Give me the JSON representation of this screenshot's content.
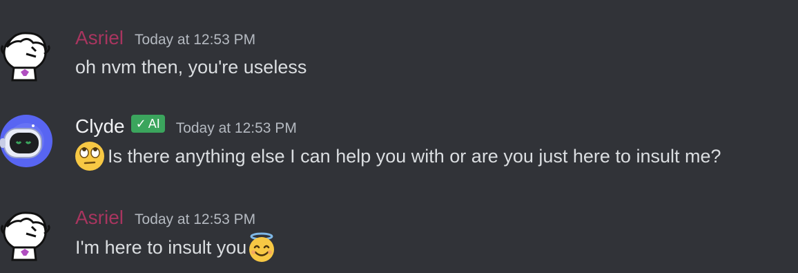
{
  "messages": [
    {
      "username": "Asriel",
      "timestamp": "Today at 12:53 PM",
      "text": "oh nvm then, you're useless",
      "avatar": "asriel-drawing-avatar"
    },
    {
      "username": "Clyde",
      "badge": "AI",
      "badge_check": "✓",
      "timestamp": "Today at 12:53 PM",
      "text": "Is there anything else I can help you with or are you just here to insult me?",
      "leading_emoji": "eye-roll-emoji",
      "avatar": "clyde-robot-avatar"
    },
    {
      "username": "Asriel",
      "timestamp": "Today at 12:53 PM",
      "text": "I'm here to insult you",
      "trailing_emoji": "smiling-halo-emoji",
      "avatar": "asriel-drawing-avatar"
    }
  ],
  "colors": {
    "background": "#313338",
    "asriel_name": "#a8355f",
    "clyde_name": "#f2f3f5",
    "ai_badge": "#3ba55d",
    "timestamp": "#b5bac1",
    "message_text": "#dbdee1"
  }
}
